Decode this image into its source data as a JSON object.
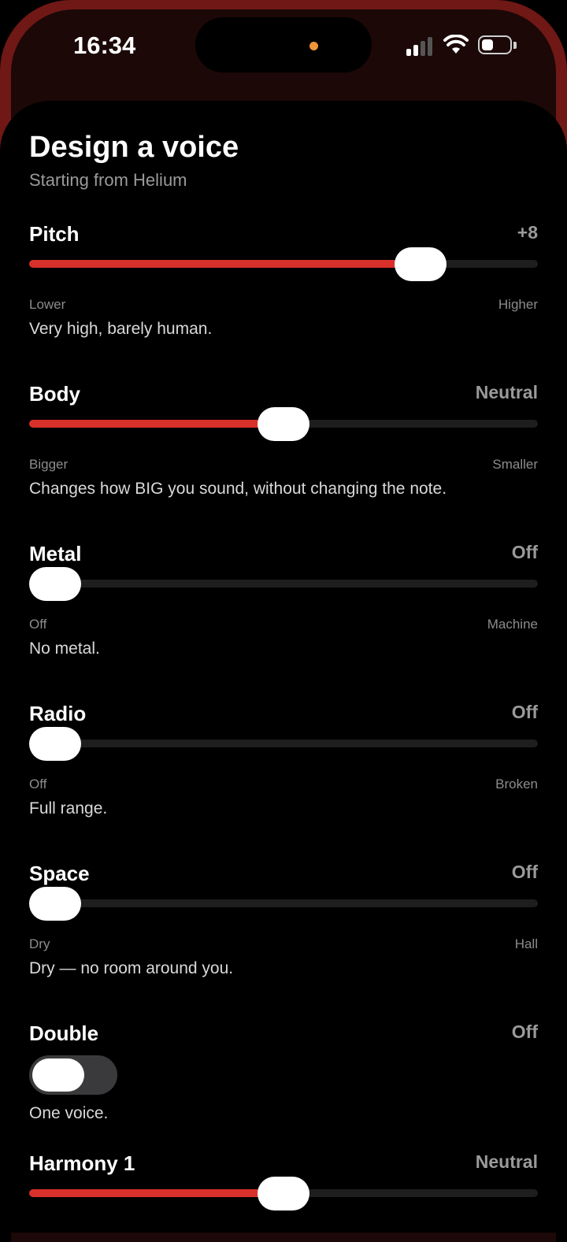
{
  "status_bar": {
    "time": "16:34"
  },
  "header": {
    "title": "Design a voice",
    "subtitle": "Starting from Helium"
  },
  "sliders": [
    {
      "id": "pitch",
      "label": "Pitch",
      "value": "+8",
      "position": 0.8,
      "fill": true,
      "min_label": "Lower",
      "max_label": "Higher",
      "description": "Very high, barely human."
    },
    {
      "id": "body",
      "label": "Body",
      "value": "Neutral",
      "position": 0.5,
      "fill": true,
      "min_label": "Bigger",
      "max_label": "Smaller",
      "description": "Changes how BIG you sound, without changing the note."
    },
    {
      "id": "metal",
      "label": "Metal",
      "value": "Off",
      "position": 0.0,
      "fill": false,
      "min_label": "Off",
      "max_label": "Machine",
      "description": "No metal."
    },
    {
      "id": "radio",
      "label": "Radio",
      "value": "Off",
      "position": 0.0,
      "fill": false,
      "min_label": "Off",
      "max_label": "Broken",
      "description": "Full range."
    },
    {
      "id": "space",
      "label": "Space",
      "value": "Off",
      "position": 0.0,
      "fill": false,
      "min_label": "Dry",
      "max_label": "Hall",
      "description": "Dry — no room around you."
    }
  ],
  "double": {
    "label": "Double",
    "value": "Off",
    "enabled": false,
    "description": "One voice."
  },
  "harmony1": {
    "label": "Harmony 1",
    "value": "Neutral",
    "position": 0.5,
    "fill": true
  },
  "colors": {
    "accent": "#d8302a",
    "track": "#1e1e1e",
    "frame": "#701815"
  }
}
